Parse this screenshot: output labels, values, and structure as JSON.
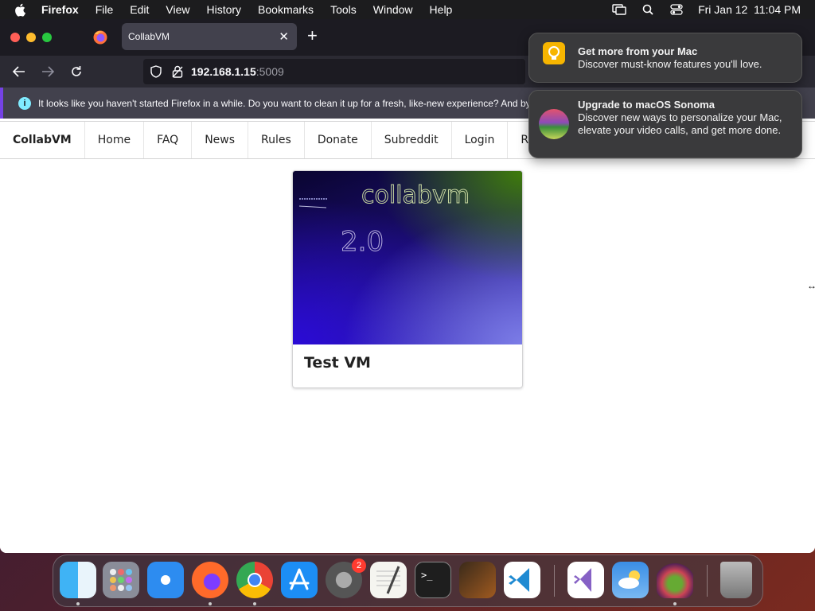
{
  "menubar": {
    "app": "Firefox",
    "items": [
      "File",
      "Edit",
      "View",
      "History",
      "Bookmarks",
      "Tools",
      "Window",
      "Help"
    ],
    "datetime": "Fri Jan 12  11:04 PM"
  },
  "browser": {
    "tab_title": "CollabVM",
    "url_host": "192.168.1.15",
    "url_port": ":5009",
    "infobar_text": "It looks like you haven't started Firefox in a while. Do you want to clean it up for a fresh, like-new experience? And by th"
  },
  "site": {
    "brand": "CollabVM",
    "nav": [
      "Home",
      "FAQ",
      "News",
      "Rules",
      "Donate",
      "Subreddit",
      "Login",
      "Register"
    ],
    "vm_card": {
      "title": "Test VM",
      "thumb_text_main": "collabvm",
      "thumb_text_version": "2.0"
    }
  },
  "notifications": [
    {
      "title": "Get more from your Mac",
      "body": "Discover must-know features you'll love."
    },
    {
      "title": "Upgrade to macOS Sonoma",
      "body": "Discover new ways to personalize your Mac, elevate your video calls, and get more done."
    }
  ],
  "dock": {
    "apps": [
      "finder",
      "launchpad",
      "safari",
      "firefox",
      "chrome",
      "app-store",
      "system-settings",
      "textedit",
      "terminal",
      "garageband",
      "vscode",
      "visual-studio",
      "weather",
      "macos-installer",
      "trash"
    ],
    "settings_badge": "2"
  }
}
